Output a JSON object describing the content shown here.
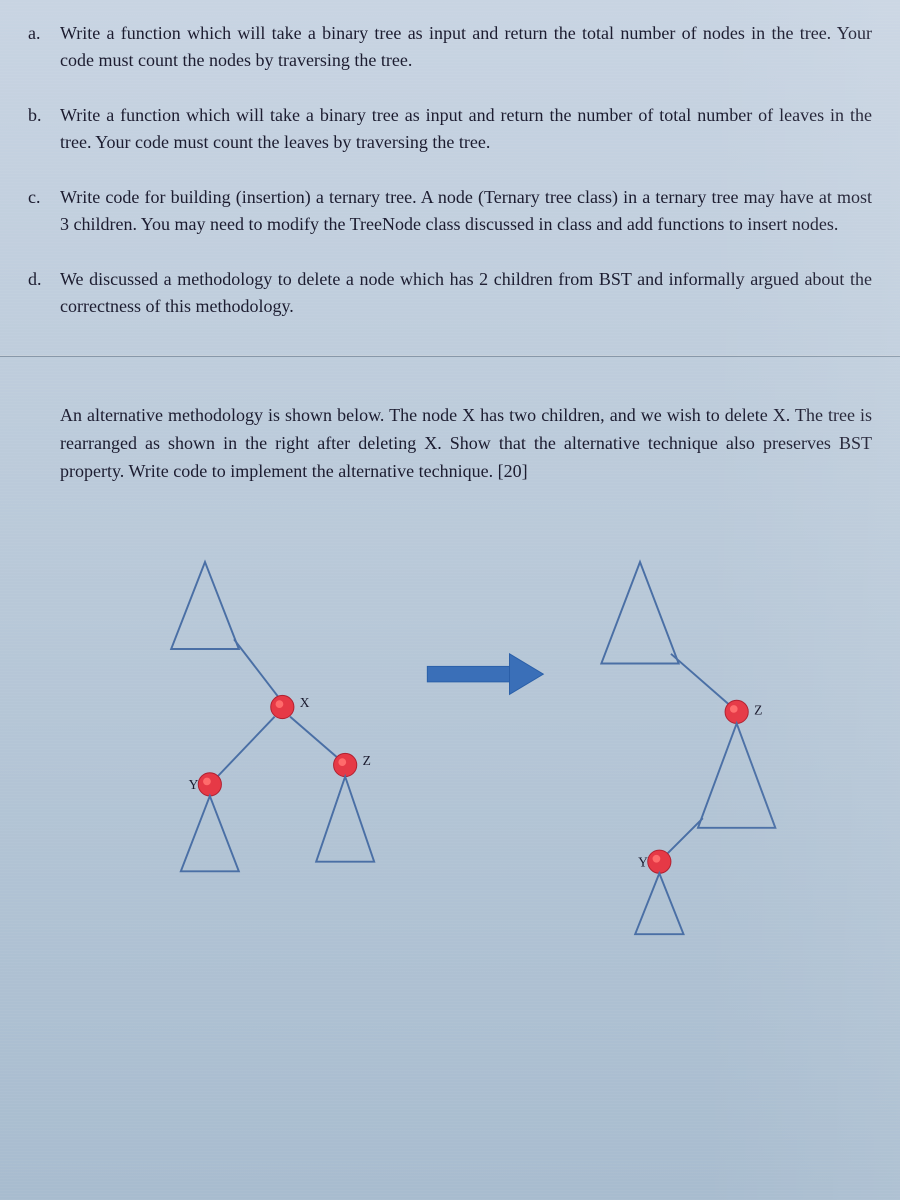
{
  "questions": [
    {
      "label": "a.",
      "text": "Write a function which will take a binary tree as input and return the total number of nodes in the tree. Your code must count the nodes by traversing the tree."
    },
    {
      "label": "b.",
      "text": "Write a function which will take a binary tree as input and return the number of total number of leaves in the tree. Your code must count the leaves by traversing the tree."
    },
    {
      "label": "c.",
      "text": "Write code for building (insertion) a ternary tree. A node (Ternary tree class) in a ternary tree may have at most 3 children. You may need to modify the TreeNode class discussed in class and add functions to insert nodes."
    },
    {
      "label": "d.",
      "text": "We discussed a methodology to delete a node which has 2 children from BST and informally argued about the correctness of this methodology."
    }
  ],
  "sub_paragraph": "An alternative methodology is shown below. The node X has two children, and we wish to delete X. The tree is rearranged as shown in the right after deleting X. Show that the alternative technique also preserves BST property. Write code to implement the alternative technique. [20]",
  "diagram": {
    "left": {
      "node_x": "X",
      "node_y": "Y",
      "node_z": "Z"
    },
    "right": {
      "node_y": "Y",
      "node_z": "Z"
    }
  }
}
